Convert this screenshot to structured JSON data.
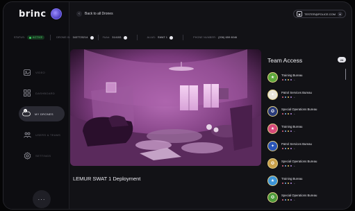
{
  "app": {
    "logo": "brinc"
  },
  "sidebar": {
    "items": [
      {
        "label": "VIDEO",
        "icon": "video-icon"
      },
      {
        "label": "DASHBOARD",
        "icon": "grid-icon"
      },
      {
        "label": "MY DRONES",
        "icon": "drone-icon",
        "active": true,
        "badge": "5"
      },
      {
        "label": "USERS & TEAMS",
        "icon": "users-icon"
      },
      {
        "label": "SETTINGS",
        "icon": "gear-icon"
      }
    ],
    "more_label": "···"
  },
  "header": {
    "back_label": "Back to all Drones",
    "user_email": "TESTER@POLICE.COM"
  },
  "info": {
    "status_label": "STATUS:",
    "status_value": "ACTIVE",
    "drone_id_label": "DRONE ID:",
    "drone_id_value": "3437720214",
    "faa_label": "FAA#:",
    "faa_value": "314153",
    "alias_label": "ALIAS:",
    "alias_value": "SWAT 1",
    "phone_label": "PHONE NUMBER:",
    "phone_value": "(206) 659 6046"
  },
  "video": {
    "deployment_title": "LEMUR SWAT 1 Deployment"
  },
  "team_access": {
    "title": "Team Access",
    "count": "24",
    "rows": [
      {
        "name": "Training Bureau",
        "seal_color": "#5fa83c",
        "seal_glyph": "★"
      },
      {
        "name": "Patrol Services Bureau",
        "seal_color": "#e8e4d8",
        "seal_glyph": "✦"
      },
      {
        "name": "Special Operations Bureau",
        "seal_color": "#2a3b7a",
        "seal_glyph": "✪"
      },
      {
        "name": "Training Bureau",
        "seal_color": "#d64a7a",
        "seal_glyph": "★"
      },
      {
        "name": "Patrol Services Bureau",
        "seal_color": "#2a55b8",
        "seal_glyph": "✦"
      },
      {
        "name": "Special Operations Bureau",
        "seal_color": "#c9a04a",
        "seal_glyph": "✪"
      },
      {
        "name": "Training Bureau",
        "seal_color": "#3d95d8",
        "seal_glyph": "★"
      },
      {
        "name": "Special Operations Bureau",
        "seal_color": "#4d9a3a",
        "seal_glyph": "✪"
      }
    ],
    "avatar_colors": [
      "#e56a8a",
      "#7bb8e8",
      "#e8c36a",
      "#b48be0"
    ],
    "more_suffix": "+"
  },
  "colors": {
    "accent": "#6b5cf0",
    "active_green": "#3ed060",
    "panel_bg": "#121216"
  }
}
